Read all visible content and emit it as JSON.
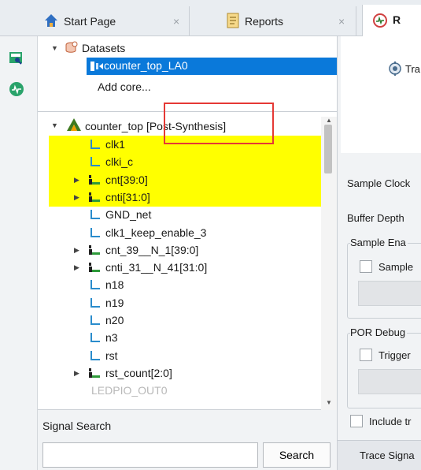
{
  "tabs": [
    {
      "label": "Start Page",
      "icon": "home-icon",
      "close": "×"
    },
    {
      "label": "Reports",
      "icon": "report-icon",
      "close": "×"
    },
    {
      "label": "R",
      "icon": "reveal-analyzer-icon"
    }
  ],
  "datasets": {
    "root_label": "Datasets",
    "items": [
      {
        "label": "counter_top_LA0",
        "selected": true
      },
      {
        "label": "Add core..."
      }
    ]
  },
  "net_tree": {
    "root_label": "counter_top",
    "root_tag": "[Post-Synthesis]",
    "signals": [
      {
        "label": "clk1",
        "type": "signal",
        "highlighted": true,
        "expandable": false
      },
      {
        "label": "clki_c",
        "type": "signal",
        "highlighted": true,
        "expandable": false
      },
      {
        "label": "cnt[39:0]",
        "type": "bus",
        "highlighted": true,
        "expandable": true
      },
      {
        "label": "cnti[31:0]",
        "type": "bus",
        "highlighted": true,
        "expandable": true
      },
      {
        "label": "GND_net",
        "type": "signal",
        "highlighted": false,
        "expandable": false
      },
      {
        "label": "clk1_keep_enable_3",
        "type": "signal",
        "highlighted": false,
        "expandable": false
      },
      {
        "label": "cnt_39__N_1[39:0]",
        "type": "bus",
        "highlighted": false,
        "expandable": true
      },
      {
        "label": "cnti_31__N_41[31:0]",
        "type": "bus",
        "highlighted": false,
        "expandable": true
      },
      {
        "label": "n18",
        "type": "signal",
        "highlighted": false,
        "expandable": false
      },
      {
        "label": "n19",
        "type": "signal",
        "highlighted": false,
        "expandable": false
      },
      {
        "label": "n20",
        "type": "signal",
        "highlighted": false,
        "expandable": false
      },
      {
        "label": "n3",
        "type": "signal",
        "highlighted": false,
        "expandable": false
      },
      {
        "label": "rst",
        "type": "signal",
        "highlighted": false,
        "expandable": false
      },
      {
        "label": "rst_count[2:0]",
        "type": "bus",
        "highlighted": false,
        "expandable": true
      },
      {
        "label": "LEDPIO_OUT0",
        "type": "faded",
        "highlighted": false,
        "expandable": false
      }
    ],
    "highlight_color": "#ffff00"
  },
  "signal_search": {
    "label": "Signal Search",
    "placeholder": "",
    "button_label": "Search"
  },
  "right_panel": {
    "trace_label": "Tra",
    "sample_clock_label": "Sample Clock",
    "buffer_depth_label": "Buffer Depth",
    "sample_enable_group": "Sample Ena",
    "sample_enable_checkbox": "Sample",
    "por_group": "POR Debug",
    "trigger_checkbox": "Trigger",
    "include_checkbox": "Include tr",
    "bottom_tab": "Trace Signa"
  },
  "left_strip_icons": [
    "zoom-dataset-icon",
    "analyzer-icon"
  ],
  "colors": {
    "accent": "#0078d7",
    "selection": "#0078d7",
    "annotation_box": "#e53935"
  }
}
